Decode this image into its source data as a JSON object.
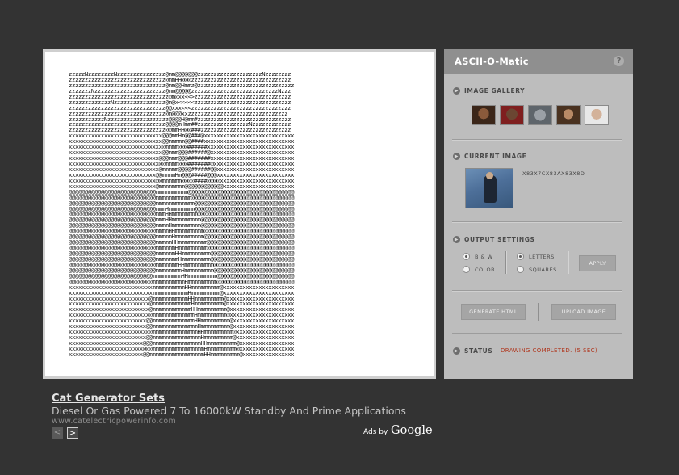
{
  "panel": {
    "title": "ASCII-O-Matic",
    "help_icon": "?",
    "sections": {
      "gallery": "IMAGE GALLERY",
      "current": "CURRENT IMAGE",
      "output": "OUTPUT SETTINGS",
      "status": "STATUS"
    },
    "current_image_meta": "X83X7CX83AX83X8D",
    "options": {
      "bw": "B & W",
      "color": "COLOR",
      "letters": "LETTERS",
      "squares": "SQUARES",
      "apply": "APPLY",
      "selected_mode": "B & W",
      "selected_render": "LETTERS"
    },
    "buttons": {
      "generate": "GENERATE HTML",
      "upload": "UPLOAD IMAGE"
    },
    "status_text": "DRAWING COMPLETED. (5 SEC)",
    "gallery_count": 5
  },
  "ad": {
    "title": "Cat Generator Sets",
    "description": "Diesel Or Gas Powered 7 To 16000kW Standby And Prime Applications",
    "url": "www.catelectricpowerinfo.com",
    "prev_icon": "<",
    "next_icon": ">",
    "ads_by": "Ads by",
    "google": "Google"
  },
  "colors": {
    "background": "#333333",
    "panel": "#bdbdbd",
    "panel_header": "#8f8f8f",
    "status": "#b0351c"
  },
  "ascii_art": "zzzzzNzzzzzzzzNzzzzzzzzzzzzzzz@mm@@@@@@@zzzzzzzzzzzzzzzzzzzzNzzzzzzzz\nzzzzzzzzzzzzzzzzzzzzzzzzzzzzzz@mmHH@@@zzzzzzzzzzzzzzzzzzzzzzzzzzzzzzz\nzzzzzzzzzzzzzzzzzzzzzzzzzzzzzz@mm@@Hmmz@zzzzzzzzzzzzzzzzzzzzzzzzzzzzzz\nzzzzzzzNzzzzzzzzzzzzzzzzzzzzzz@mm@@@@@zzzzzzzzzzzzzzzzzzzzzzzzzzzNzzz\nzzzzzzzzzzzzzzzzzzzzzzzzzzzzzzz@m@xx<<>zzzzzzzzzzzzzzzzzzzzzzzzzzzzzz\nzzzzzzzzzzzzzNzzzzzzzzzzzzzzzz@m@x<<<<<zzzzzzzzzzzzzzzzzzzzzzzzzzzzzz\nzzzzzzzzzzzzzzzzzzzzzzzzzzzzzz@@xxx<<<zzzzzzzzzzzzzzzzzzzzzzzzzzzzzzz\nzzzzzzzzzzzzzzzzzzzzzzzzzzzzzz@m@@@xxzzzzzzzzzzzzzzzzzzzzzzzzzzzzzzz\nzzzzzzzzzzzNzzzzzzzzzzzzzzzzzzz@@@@H@mm#zzzzzzzzzzzzzzzzzzzzzzzzzzzzz\nzzzzzzzzzzzzzzzzzzzzzzzzzzzzzz@@@@mHmm##zzzzzzzzzzzzzzzzNzzzzzzzzzzzz\nzzzzzzzzzzzzzzzzzzzzzzzzzzzzzz@@mmHH@@###zzzzzzzzzzzzzzzzzzzzzzzzzzzz\nxxxxxxxxxxxxxxxxxxxxxxxxxxxxx@@@mmHm@@###@xxxxxxxxxxxxxxxxxxxxxxxxxxxx\nxxxxxxxxxxxxxxxxxxxxxxxxxxxxx@@mmmmm@@####xxxxxxxxxxxxxxxxxxxxxxxxxxxx\nxxxxxxxxxxxxxxxxxxxxxxxxxxxxx@mmmm@@@######xxxxxxxxxxxxxxxxxxxxxxxxxxx\nxxxxxxxxxxxxxxxxxxxxxxxxxxxxx@@mmm@@@######@xxxxxxxxxxxxxxxxxxxxxxxxxx\nxxxxxxxxxxxxxxxxxxxxxxxxxxxx@@@mmm@@@#######xxxxxxxxxxxxxxxxxxxxxxxxxx\nxxxxxxxxxxxxxxxxxxxxxxxxxxxx@@mmmm@@@#######@xxxxxxxxxxxxxxxxxxxxxxxxx\nxxxxxxxxxxxxxxxxxxxxxxxxxxxx@mmmmm@@@@######@@xxxxxxxxxxxxxxxxxxxxxxxx\nxxxxxxxxxxxxxxxxxxxxxxxxxxx@@mmmmHm@@@#####@@@xxxxxxxxxxxxxxxxxxxxxxxx\nxxxxxxxxxxxxxxxxxxxxxxxxxxx@@mmmmmm@@@@####@@@@xxxxxxxxxxxxxxxxxxxxxxx\nxxxxxxxxxxxxxxxxxxxxxxxxxxx@mmmmmmmm@@@@@@@@@@@@xxxxxxxxxxxxxxxxxxxxxx\n@@@@@@@@@@@@@@@@@@@@@@@@@@@mmmmmmmmmm@@@@@@@@@@@@@@@@@@@@@@@@@@@@@@@@@\n@@@@@@@@@@@@@@@@@@@@@@@@@@@mmmmmmmmmmm@@@@@@@@@@@@@@@@@@@@@@@@@@@@@@@@\n@@@@@@@@@@@@@@@@@@@@@@@@@@@mmmmmmmmmmmm@@@@@@@@@@@@@@@@@@@@@@@@@@@@@@@\n@@@@@@@@@@@@@@@@@@@@@@@@@@@mmmHmmmmmmmm@@@@@@@@@@@@@@@@@@@@@@@@@@@@@@@\n@@@@@@@@@@@@@@@@@@@@@@@@@@@mmmHHmmmmmmmm@@@@@@@@@@@@@@@@@@@@@@@@@@@@@@\n@@@@@@@@@@@@@@@@@@@@@@@@@@@mmmHHmmmmmmmmm@@@@@@@@@@@@@@@@@@@@@@@@@@@@@\n@@@@@@@@@@@@@@@@@@@@@@@@@@@mmmmHmmmmmmmmm@@@@@@@@@@@@@@@@@@@@@@@@@@@@@\n@@@@@@@@@@@@@@@@@@@@@@@@@@@mmmmHHmmmmmmmmm@@@@@@@@@@@@@@@@@@@@@@@@@@@@\n@@@@@@@@@@@@@@@@@@@@@@@@@@@mmmmmHmmmmmmmmm@@@@@@@@@@@@@@@@@@@@@@@@@@@@\n@@@@@@@@@@@@@@@@@@@@@@@@@@@mmmmmHHmmmmmmmmm@@@@@@@@@@@@@@@@@@@@@@@@@@@\n@@@@@@@@@@@@@@@@@@@@@@@@@@@mmmmmmHmmmmmmmmm@@@@@@@@@@@@@@@@@@@@@@@@@@@\n@@@@@@@@@@@@@@@@@@@@@@@@@@@mmmmmmHHmmmmmmmmm@@@@@@@@@@@@@@@@@@@@@@@@@@\n@@@@@@@@@@@@@@@@@@@@@@@@@@@mmmmmmmHmmmmmmmmm@@@@@@@@@@@@@@@@@@@@@@@@@@\n@@@@@@@@@@@@@@@@@@@@@@@@@@@mmmmmmmHHmmmmmmmmm@@@@@@@@@@@@@@@@@@@@@@@@@\n@@@@@@@@@@@@@@@@@@@@@@@@@@@mmmmmmmmHmmmmmmmmm@@@@@@@@@@@@@@@@@@@@@@@@@\n@@@@@@@@@@@@@@@@@@@@@@@@@@mmmmmmmmmHHmmmmmmmmm@@@@@@@@@@@@@@@@@@@@@@@@\n@@@@@@@@@@@@@@@@@@@@@@@@@@mmmmmmmmmmHmmmmmmmmm@@@@@@@@@@@@@@@@@@@@@@@@\nxxxxxxxxxxxxxxxxxxxxxxxxxxmmmmmmmmmmHHmmmmmmmmm@xxxxxxxxxxxxxxxxxxxxxx\nxxxxxxxxxxxxxxxxxxxxxxxxxxmmmmmmmmmmmHmmmmmmmmm@xxxxxxxxxxxxxxxxxxxxxx\nxxxxxxxxxxxxxxxxxxxxxxxxx@mmmmmmmmmmmHHmmmmmmmmm@xxxxxxxxxxxxxxxxxxxxx\nxxxxxxxxxxxxxxxxxxxxxxxxx@mmmmmmmmmmmmHmmmmmmmmm@xxxxxxxxxxxxxxxxxxxxx\nxxxxxxxxxxxxxxxxxxxxxxxxx@mmmmmmmmmmmmHHmmmmmmmmm@xxxxxxxxxxxxxxxxxxxx\nxxxxxxxxxxxxxxxxxxxxxxxxx@mmmmmmmmmmmmmHmmmmmmmmm@xxxxxxxxxxxxxxxxxxxx\nxxxxxxxxxxxxxxxxxxxxxxxx@@mmmmmmmmmmmmmHHmmmmmmmmm@xxxxxxxxxxxxxxxxxxx\nxxxxxxxxxxxxxxxxxxxxxxxx@@mmmmmmmmmmmmmmHmmmmmmmmm@xxxxxxxxxxxxxxxxxxx\nxxxxxxxxxxxxxxxxxxxxxxxx@@mmmmmmmmmmmmmmHHmmmmmmmmm@xxxxxxxxxxxxxxxxxx\nxxxxxxxxxxxxxxxxxxxxxxxx@@mmmmmmmmmmmmmmmHmmmmmmmmm@xxxxxxxxxxxxxxxxxx\nxxxxxxxxxxxxxxxxxxxxxxx@@@mmmmmmmmmmmmmmmHHmmmmmmmmm@xxxxxxxxxxxxxxxxx\nxxxxxxxxxxxxxxxxxxxxxxx@@@mmmmmmmmmmmmmmmmHmmmmmmmmm@xxxxxxxxxxxxxxxxx\nxxxxxxxxxxxxxxxxxxxxxxx@@mmmmmmmmmmmmmmmmmHHmmmmmmmmm@xxxxxxxxxxxxxxxx"
}
